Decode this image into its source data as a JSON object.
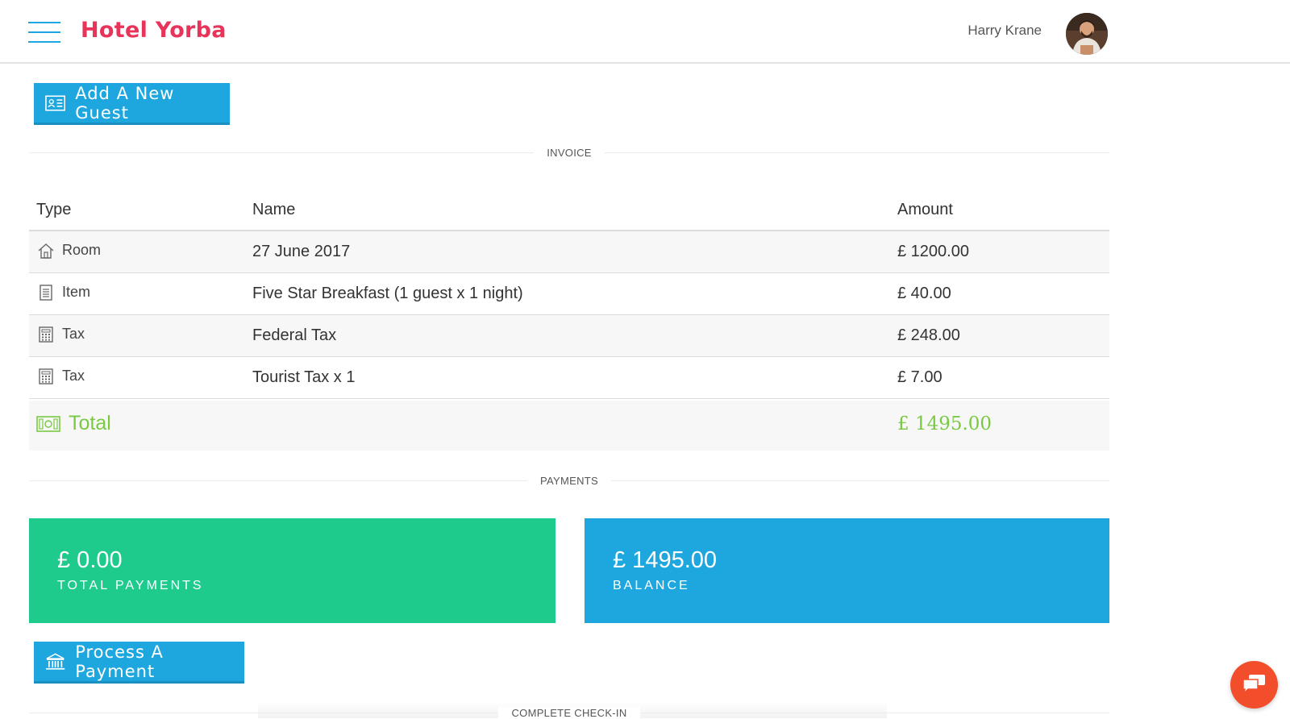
{
  "header": {
    "brand": "Hotel Yorba",
    "user_name": "Harry Krane"
  },
  "actions": {
    "add_guest_label": "Add A New Guest",
    "process_payment_label": "Process A Payment"
  },
  "sections": {
    "invoice": "INVOICE",
    "payments": "PAYMENTS",
    "complete_checkin": "COMPLETE CHECK-IN"
  },
  "invoice": {
    "columns": {
      "type": "Type",
      "name": "Name",
      "amount": "Amount"
    },
    "rows": [
      {
        "type": "Room",
        "icon": "home-icon",
        "name": "27 June 2017",
        "amount": "£ 1200.00"
      },
      {
        "type": "Item",
        "icon": "receipt-icon",
        "name": "Five Star Breakfast (1 guest x 1 night)",
        "amount": "£ 40.00"
      },
      {
        "type": "Tax",
        "icon": "calculator-icon",
        "name": "Federal Tax",
        "amount": "£ 248.00"
      },
      {
        "type": "Tax",
        "icon": "calculator-icon",
        "name": "Tourist Tax x 1",
        "amount": "£ 7.00"
      }
    ],
    "total": {
      "label": "Total",
      "icon": "money-icon",
      "amount": "£ 1495.00"
    }
  },
  "payments": {
    "total_payments": {
      "value": "£ 0.00",
      "label": "TOTAL PAYMENTS"
    },
    "balance": {
      "value": "£ 1495.00",
      "label": "BALANCE"
    }
  },
  "colors": {
    "accent_blue": "#1ea7df",
    "brand_red": "#e8345a",
    "green": "#1ecb8c",
    "total_green": "#7ac943",
    "chat_orange": "#f24e2b"
  }
}
